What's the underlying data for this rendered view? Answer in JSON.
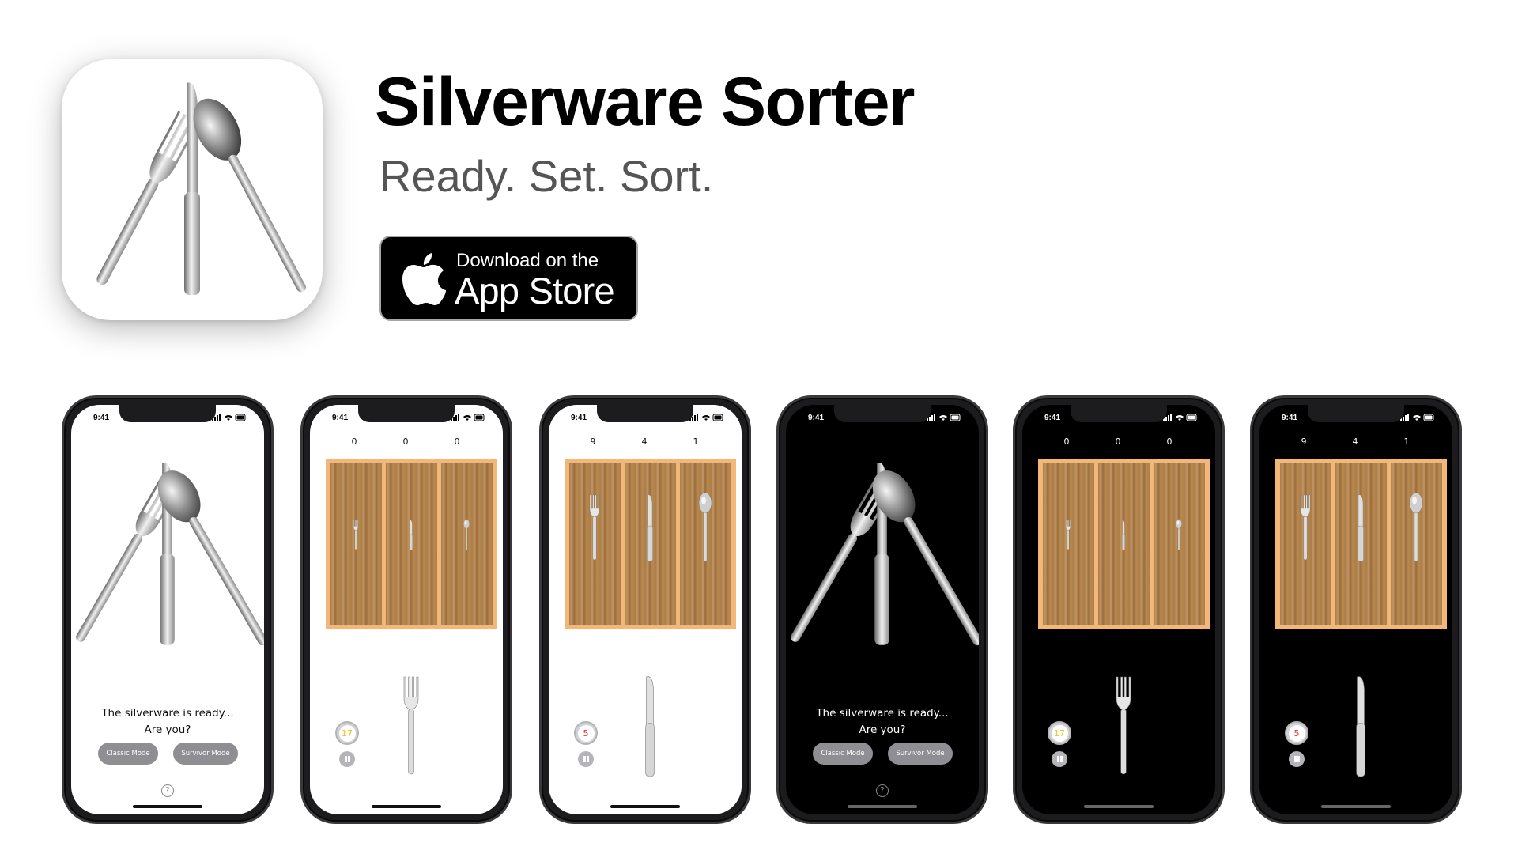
{
  "header": {
    "title": "Silverware Sorter",
    "tagline": "Ready. Set. Sort."
  },
  "store_badge": {
    "line1": "Download on the",
    "line2": "App Store"
  },
  "phones": [
    {
      "theme": "light",
      "screen": "menu",
      "time": "9:41",
      "prompt_line1": "The silverware is ready...",
      "prompt_line2": "Are you?",
      "classic_mode": "Classic Mode",
      "survivor_mode": "Survivor Mode",
      "help": "?"
    },
    {
      "theme": "light",
      "screen": "game",
      "time": "9:41",
      "scores": [
        "0",
        "0",
        "0"
      ],
      "timer": "17",
      "timer_color": "yellow",
      "incoming": "fork"
    },
    {
      "theme": "light",
      "screen": "game",
      "time": "9:41",
      "scores": [
        "9",
        "4",
        "1"
      ],
      "timer": "5",
      "timer_color": "red",
      "incoming": "knife"
    },
    {
      "theme": "dark",
      "screen": "menu",
      "time": "9:41",
      "prompt_line1": "The silverware is ready...",
      "prompt_line2": "Are you?",
      "classic_mode": "Classic Mode",
      "survivor_mode": "Survivor Mode",
      "help": "?"
    },
    {
      "theme": "dark",
      "screen": "game",
      "time": "9:41",
      "scores": [
        "0",
        "0",
        "0"
      ],
      "timer": "17",
      "timer_color": "yellow",
      "incoming": "fork"
    },
    {
      "theme": "dark",
      "screen": "game",
      "time": "9:41",
      "scores": [
        "9",
        "4",
        "1"
      ],
      "timer": "5",
      "timer_color": "red",
      "incoming": "knife"
    }
  ],
  "colors": {
    "tray_frame": "#f3b77a",
    "timer_yellow": "#f0c419",
    "timer_red": "#e5342a",
    "mode_button": "#8e8e93"
  }
}
